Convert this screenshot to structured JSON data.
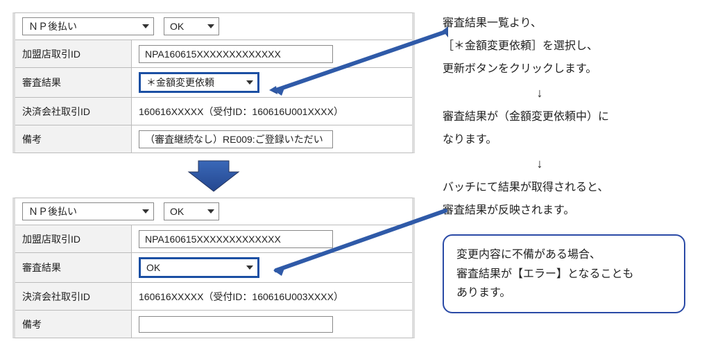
{
  "panel1": {
    "select_payment": "ＮＰ後払い",
    "select_status": "OK",
    "rows": {
      "merchant_id_label": "加盟店取引ID",
      "merchant_id_value": "NPA160615XXXXXXXXXXXXX",
      "result_label": "審査結果",
      "result_select": "＊金額変更依頼",
      "company_id_label": "決済会社取引ID",
      "company_id_value": "160616XXXXX（受付ID：160616U001XXXX）",
      "note_label": "備考",
      "note_value": "（審査継続なし）RE009:ご登録いただい"
    }
  },
  "panel2": {
    "select_payment": "ＮＰ後払い",
    "select_status": "OK",
    "rows": {
      "merchant_id_label": "加盟店取引ID",
      "merchant_id_value": "NPA160615XXXXXXXXXXXXX",
      "result_label": "審査結果",
      "result_select": "OK",
      "company_id_label": "決済会社取引ID",
      "company_id_value": "160616XXXXX（受付ID：160616U003XXXX）",
      "note_label": "備考",
      "note_value": ""
    }
  },
  "right": {
    "p1a": "審査結果一覧より、",
    "p1b": "［＊金額変更依頼］を選択し、",
    "p1c": "更新ボタンをクリックします。",
    "arrow1": "↓",
    "p2a": "審査結果が（金額変更依頼中）に",
    "p2b": "なります。",
    "arrow2": "↓",
    "p3a": "バッチにて結果が取得されると、",
    "p3b": "審査結果が反映されます。",
    "bubble1": "変更内容に不備がある場合、",
    "bubble2": "審査結果が【エラー】となることも",
    "bubble3": "あります。"
  }
}
